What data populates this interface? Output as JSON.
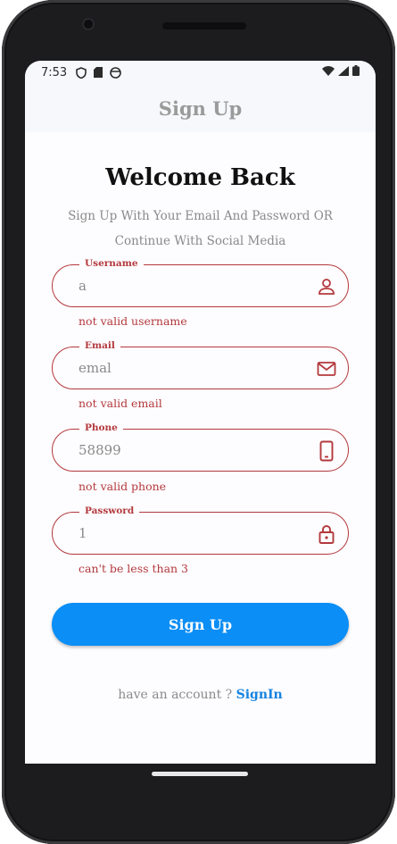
{
  "status_bar": {
    "time": "7:53"
  },
  "app_bar": {
    "title": "Sign Up"
  },
  "header": {
    "title": "Welcome Back",
    "subtitle_line1": "Sign Up With Your Email And Password OR",
    "subtitle_line2": "Continue With Social Media"
  },
  "form": {
    "username": {
      "label": "Username",
      "value": "a",
      "error": "not valid username",
      "icon": "person-icon"
    },
    "email": {
      "label": "Email",
      "value": "emal",
      "error": "not valid email",
      "icon": "mail-icon"
    },
    "phone": {
      "label": "Phone",
      "value": "58899",
      "error": "not valid phone",
      "icon": "phone-icon"
    },
    "password": {
      "label": "Password",
      "value": "1",
      "error": "can't be less than 3",
      "icon": "lock-icon"
    }
  },
  "submit": {
    "label": "Sign Up"
  },
  "footer": {
    "text": "have an account ? ",
    "link": "SignIn"
  },
  "colors": {
    "error": "#b3393d",
    "primary": "#0b8ef6",
    "link": "#1683e0",
    "muted": "#8a8a8a"
  }
}
